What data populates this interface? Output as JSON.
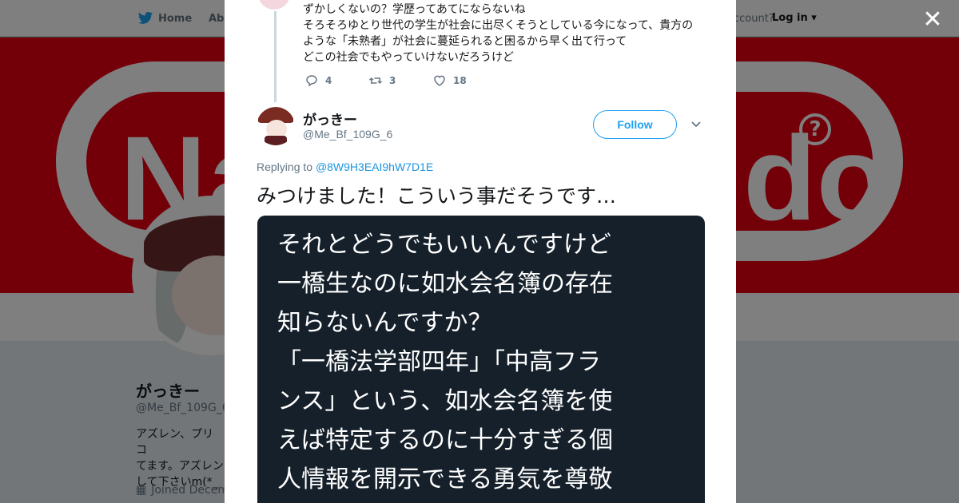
{
  "nav": {
    "home_label": "Home",
    "about_label": "Abo",
    "account_text": "ccount?",
    "login_label": "Log in"
  },
  "background_profile": {
    "name": "がっきー",
    "handle": "@Me_Bf_109G_6",
    "bio": "アズレン、プリコ\nてます。アズレン\nして下さいm(*_",
    "joined": "Joined Decem"
  },
  "previous_tweet": {
    "lines": [
      "ずかしくないの？学歴ってあてにならないね",
      "そろそろゆとり世代の学生が社会に出尽くそうとしている今になって、貴方の",
      "ような「未熟者」が社会に蔓延られると困るから早く出て行って",
      "どこの社会でもやっていけないだろうけど"
    ],
    "replies": "4",
    "retweets": "3",
    "likes": "18"
  },
  "tweet": {
    "name": "がっきー",
    "handle": "@Me_Bf_109G_6",
    "follow_label": "Follow",
    "replying_prefix": "Replying to",
    "replying_to": "@8W9H3EAI9hW7D1E",
    "text": "みつけました！こういう事だそうです…"
  },
  "media": {
    "lines": [
      "それとどうでもいいんですけど",
      "一橋生なのに如水会名簿の存在",
      "知らないんですか？",
      "「一橋法学部四年」「中高フラ",
      "ンス」という、如水会名簿を使",
      "えば特定するのに十分すぎる個",
      "人情報を開示できる勇気を尊敬"
    ]
  },
  "colors": {
    "accent": "#1da1f2",
    "banner": "#e60012",
    "media_bg": "#15202b"
  }
}
